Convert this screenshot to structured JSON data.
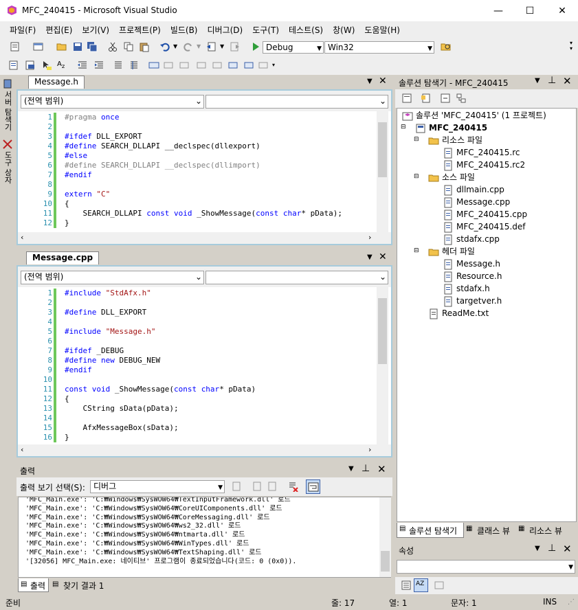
{
  "window": {
    "title": "MFC_240415 - Microsoft Visual Studio",
    "minimize": "—",
    "maximize": "☐",
    "close": "✕"
  },
  "menu": [
    "파일(F)",
    "편집(E)",
    "보기(V)",
    "프로젝트(P)",
    "빌드(B)",
    "디버그(D)",
    "도구(T)",
    "테스트(S)",
    "창(W)",
    "도움말(H)"
  ],
  "toolbar": {
    "config": "Debug",
    "platform": "Win32"
  },
  "left_strip": {
    "server_explorer": "서버 탐색기",
    "toolbox": "도구 상자"
  },
  "editor1": {
    "tab": "Message.h",
    "scope": "(전역 범위)",
    "member": "",
    "lines": [
      {
        "n": "1",
        "parts": [
          {
            "c": "grey",
            "t": "#pragma "
          },
          {
            "c": "kw",
            "t": "once"
          }
        ]
      },
      {
        "n": "2",
        "parts": []
      },
      {
        "n": "3",
        "parts": [
          {
            "c": "kw",
            "t": "#ifdef"
          },
          {
            "c": "",
            "t": " DLL_EXPORT"
          }
        ]
      },
      {
        "n": "4",
        "parts": [
          {
            "c": "kw",
            "t": "#define"
          },
          {
            "c": "",
            "t": " SEARCH_DLLAPI __declspec(dllexport)"
          }
        ]
      },
      {
        "n": "5",
        "parts": [
          {
            "c": "kw",
            "t": "#else"
          }
        ]
      },
      {
        "n": "6",
        "parts": [
          {
            "c": "grey",
            "t": "#define SEARCH_DLLAPI __declspec(dllimport)"
          }
        ]
      },
      {
        "n": "7",
        "parts": [
          {
            "c": "kw",
            "t": "#endif"
          }
        ]
      },
      {
        "n": "8",
        "parts": []
      },
      {
        "n": "9",
        "parts": [
          {
            "c": "kw",
            "t": "extern "
          },
          {
            "c": "str",
            "t": "\"C\""
          }
        ]
      },
      {
        "n": "10",
        "parts": [
          {
            "c": "",
            "t": "{"
          }
        ]
      },
      {
        "n": "11",
        "parts": [
          {
            "c": "",
            "t": "    SEARCH_DLLAPI "
          },
          {
            "c": "kw",
            "t": "const void"
          },
          {
            "c": "",
            "t": " _ShowMessage("
          },
          {
            "c": "kw",
            "t": "const char"
          },
          {
            "c": "",
            "t": "* pData);"
          }
        ]
      },
      {
        "n": "12",
        "parts": [
          {
            "c": "",
            "t": "}"
          }
        ]
      }
    ]
  },
  "editor2": {
    "tab": "Message.cpp",
    "scope": "(전역 범위)",
    "member": "",
    "lines": [
      {
        "n": "1",
        "parts": [
          {
            "c": "kw",
            "t": "#include "
          },
          {
            "c": "str",
            "t": "\"StdAfx.h\""
          }
        ]
      },
      {
        "n": "2",
        "parts": []
      },
      {
        "n": "3",
        "parts": [
          {
            "c": "kw",
            "t": "#define"
          },
          {
            "c": "",
            "t": " DLL_EXPORT"
          }
        ]
      },
      {
        "n": "4",
        "parts": []
      },
      {
        "n": "5",
        "parts": [
          {
            "c": "kw",
            "t": "#include "
          },
          {
            "c": "str",
            "t": "\"Message.h\""
          }
        ]
      },
      {
        "n": "6",
        "parts": []
      },
      {
        "n": "7",
        "parts": [
          {
            "c": "kw",
            "t": "#ifdef"
          },
          {
            "c": "",
            "t": " _DEBUG"
          }
        ]
      },
      {
        "n": "8",
        "parts": [
          {
            "c": "kw",
            "t": "#define"
          },
          {
            "c": "",
            "t": " "
          },
          {
            "c": "kw",
            "t": "new"
          },
          {
            "c": "",
            "t": " DEBUG_NEW"
          }
        ]
      },
      {
        "n": "9",
        "parts": [
          {
            "c": "kw",
            "t": "#endif"
          }
        ]
      },
      {
        "n": "10",
        "parts": []
      },
      {
        "n": "11",
        "parts": [
          {
            "c": "kw",
            "t": "const void"
          },
          {
            "c": "",
            "t": " _ShowMessage("
          },
          {
            "c": "kw",
            "t": "const char"
          },
          {
            "c": "",
            "t": "* pData)"
          }
        ]
      },
      {
        "n": "12",
        "parts": [
          {
            "c": "",
            "t": "{"
          }
        ]
      },
      {
        "n": "13",
        "parts": [
          {
            "c": "",
            "t": "    CString sData(pData);"
          }
        ]
      },
      {
        "n": "14",
        "parts": []
      },
      {
        "n": "15",
        "parts": [
          {
            "c": "",
            "t": "    AfxMessageBox(sData);"
          }
        ]
      },
      {
        "n": "16",
        "parts": [
          {
            "c": "",
            "t": "}"
          }
        ]
      }
    ]
  },
  "output": {
    "title": "출력",
    "show_label": "출력 보기 선택(S):",
    "show_value": "디버그",
    "lines": [
      "'MFC_Main.exe': 'C:₩Windows₩SysWOW64₩TextInputFramework.dll' 로드",
      "'MFC_Main.exe': 'C:₩Windows₩SysWOW64₩CoreUIComponents.dll' 로드",
      "'MFC_Main.exe': 'C:₩Windows₩SysWOW64₩CoreMessaging.dll' 로드",
      "'MFC_Main.exe': 'C:₩Windows₩SysWOW64₩ws2_32.dll' 로드",
      "'MFC_Main.exe': 'C:₩Windows₩SysWOW64₩ntmarta.dll' 로드",
      "'MFC_Main.exe': 'C:₩Windows₩SysWOW64₩WinTypes.dll' 로드",
      "'MFC_Main.exe': 'C:₩Windows₩SysWOW64₩TextShaping.dll' 로드",
      "'[32056] MFC_Main.exe: 네이티브' 프로그램이 종료되었습니다(코드: 0 (0x0))."
    ],
    "tabs": [
      "출력",
      "찾기 결과 1"
    ]
  },
  "solution": {
    "title": "솔루션 탐색기 - MFC_240415",
    "root": "솔루션 'MFC_240415' (1 프로젝트)",
    "project": "MFC_240415",
    "folders": [
      {
        "name": "리소스 파일",
        "files": [
          "MFC_240415.rc",
          "MFC_240415.rc2"
        ]
      },
      {
        "name": "소스 파일",
        "files": [
          "dllmain.cpp",
          "Message.cpp",
          "MFC_240415.cpp",
          "MFC_240415.def",
          "stdafx.cpp"
        ]
      },
      {
        "name": "헤더 파일",
        "files": [
          "Message.h",
          "Resource.h",
          "stdafx.h",
          "targetver.h"
        ]
      }
    ],
    "readme": "ReadMe.txt",
    "tabs": [
      "솔루션 탐색기",
      "클래스 뷰",
      "리소스 뷰"
    ]
  },
  "properties": {
    "title": "속성"
  },
  "status": {
    "ready": "준비",
    "line": "줄: 17",
    "col": "열: 1",
    "char": "문자: 1",
    "mode": "INS"
  }
}
